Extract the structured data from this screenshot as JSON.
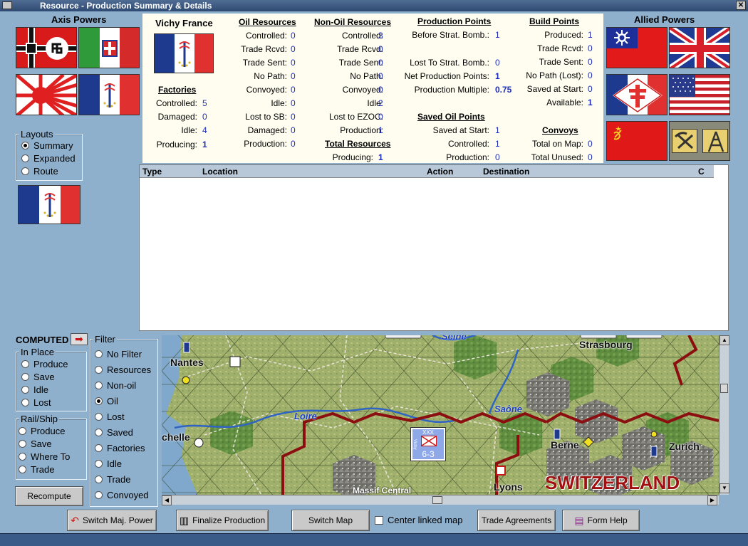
{
  "window": {
    "title": "Resource - Production Summary & Details"
  },
  "axis": {
    "title": "Axis Powers"
  },
  "allied": {
    "title": "Allied Powers"
  },
  "layouts": {
    "label": "Layouts",
    "options": [
      "Summary",
      "Expanded",
      "Route"
    ],
    "selected": "Summary"
  },
  "nation": {
    "name": "Vichy France"
  },
  "factories": {
    "heading": "Factories",
    "rows": [
      {
        "label": "Controlled:",
        "value": "5"
      },
      {
        "label": "Damaged:",
        "value": "0"
      },
      {
        "label": "Idle:",
        "value": "4"
      },
      {
        "label": "Producing:",
        "value": "1"
      }
    ]
  },
  "oil": {
    "heading": "Oil Resources",
    "rows": [
      {
        "label": "Controlled:",
        "value": "0"
      },
      {
        "label": "Trade Rcvd:",
        "value": "0"
      },
      {
        "label": "Trade Sent:",
        "value": "0"
      },
      {
        "label": "No Path:",
        "value": "0"
      },
      {
        "label": "Convoyed:",
        "value": "0"
      },
      {
        "label": "Idle:",
        "value": "0"
      },
      {
        "label": "Lost to SB:",
        "value": "0"
      },
      {
        "label": "Damaged:",
        "value": "0"
      },
      {
        "label": "Production:",
        "value": "0"
      }
    ]
  },
  "nonoil": {
    "heading": "Non-Oil Resources",
    "rows": [
      {
        "label": "Controlled:",
        "value": "3"
      },
      {
        "label": "Trade Rcvd:",
        "value": "0"
      },
      {
        "label": "Trade Sent:",
        "value": "0"
      },
      {
        "label": "No Path:",
        "value": "0"
      },
      {
        "label": "Convoyed:",
        "value": "0"
      },
      {
        "label": "Idle:",
        "value": "2"
      },
      {
        "label": "Lost to EZOC:",
        "value": "0"
      },
      {
        "label": "Production:",
        "value": "1"
      }
    ]
  },
  "total": {
    "heading": "Total Resources",
    "label": "Producing:",
    "value": "1"
  },
  "pp": {
    "heading": "Production Points",
    "rows": [
      {
        "label": "Before Strat. Bomb.:",
        "value": "1"
      },
      {
        "label": "Lost To Strat. Bomb.:",
        "value": "0"
      },
      {
        "label": "Net Production Points:",
        "value": "1"
      },
      {
        "label": "Production Multiple:",
        "value": "0.75"
      }
    ]
  },
  "saved_oil": {
    "heading": "Saved Oil Points",
    "rows": [
      {
        "label": "Saved at Start:",
        "value": "1"
      },
      {
        "label": "Controlled:",
        "value": "1"
      },
      {
        "label": "Production:",
        "value": "0"
      }
    ]
  },
  "bp": {
    "heading": "Build Points",
    "rows": [
      {
        "label": "Produced:",
        "value": "1"
      },
      {
        "label": "Trade Rcvd:",
        "value": "0"
      },
      {
        "label": "Trade Sent:",
        "value": "0"
      },
      {
        "label": "No Path (Lost):",
        "value": "0"
      },
      {
        "label": "Saved at Start:",
        "value": "0"
      },
      {
        "label": "Available:",
        "value": "1"
      }
    ]
  },
  "convoys": {
    "heading": "Convoys",
    "rows": [
      {
        "label": "Total on Map:",
        "value": "0"
      },
      {
        "label": "Total Unused:",
        "value": "0"
      }
    ]
  },
  "table": {
    "columns": [
      "Type",
      "Location",
      "Action",
      "Destination",
      "C"
    ]
  },
  "computed": {
    "label": "COMPUTED"
  },
  "inplace": {
    "label": "In Place",
    "options": [
      "Produce",
      "Save",
      "Idle",
      "Lost"
    ]
  },
  "railship": {
    "label": "Rail/Ship",
    "options": [
      "Produce",
      "Save",
      "Where To",
      "Trade"
    ]
  },
  "filter": {
    "label": "Filter",
    "options": [
      "No Filter",
      "Resources",
      "Non-oil",
      "Oil",
      "Lost",
      "Saved",
      "Factories",
      "Idle",
      "Trade",
      "Convoyed"
    ],
    "selected": "Oil"
  },
  "recompute": {
    "label": "Recompute"
  },
  "map": {
    "cities": [
      "Nantes",
      "Strasbourg",
      "chelle",
      "Berne",
      "Zurich",
      "Lyons"
    ],
    "rivers": [
      "Loire",
      "Saône",
      "Seine"
    ],
    "regions": [
      "Massif Central",
      "SWITZERLAND"
    ],
    "unit": {
      "top": "XXX",
      "side": "Vichy",
      "strength": "6-3"
    }
  },
  "buttons": {
    "switch_power": "Switch Maj. Power",
    "finalize": "Finalize Production",
    "switch_map": "Switch Map",
    "center_linked": "Center linked map",
    "trade": "Trade Agreements",
    "help": "Form Help"
  },
  "colors": {
    "window_bg": "#8fb0cc",
    "panel_bg": "#fffdf0",
    "value_blue": "#1f2fb8",
    "border_red": "#8b0f10",
    "river_blue": "#2f64c4"
  }
}
